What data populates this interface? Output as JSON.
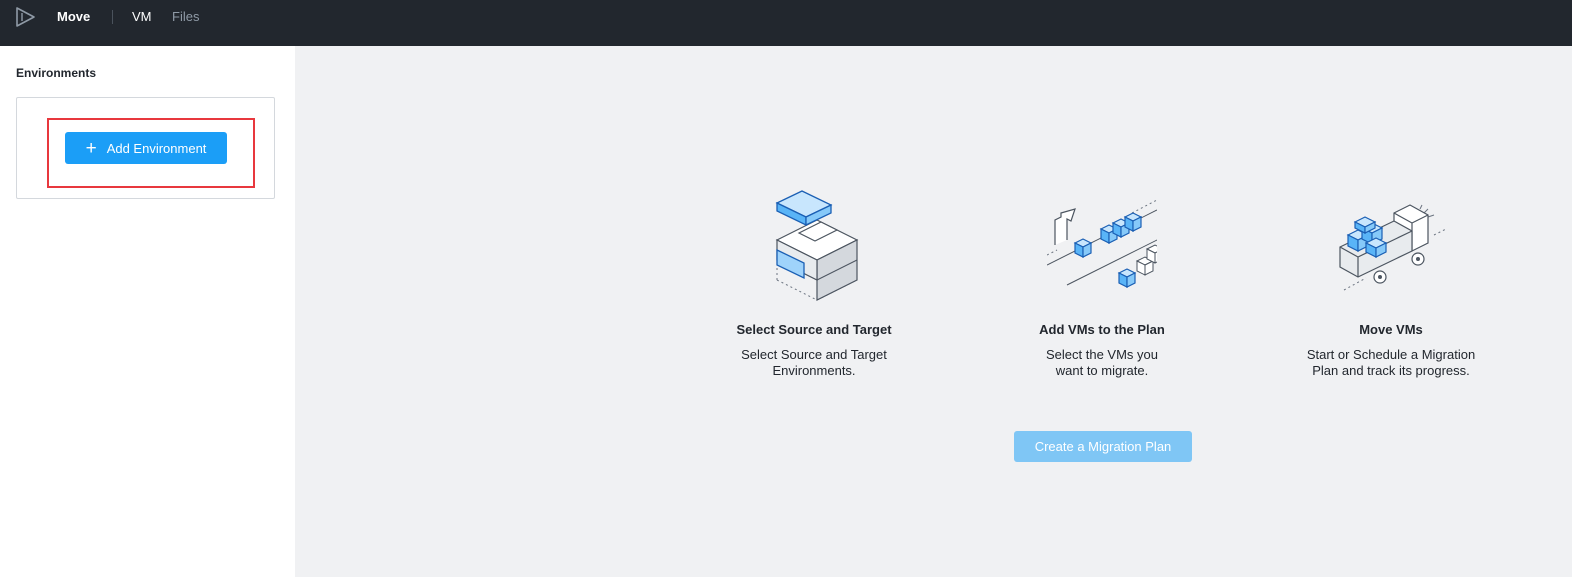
{
  "header": {
    "app_name": "Move",
    "nav": {
      "vm": "VM",
      "files": "Files"
    },
    "logo_icon": "play-logo-icon"
  },
  "sidebar": {
    "title": "Environments",
    "add_button_label": "Add Environment",
    "add_icon": "plus-icon"
  },
  "steps": [
    {
      "icon": "source-target-blocks-icon",
      "title": "Select Source and Target",
      "desc_line1": "Select Source and Target",
      "desc_line2": "Environments."
    },
    {
      "icon": "add-vms-conveyor-icon",
      "title": "Add VMs to the Plan",
      "desc_line1": "Select the VMs you",
      "desc_line2": "want to migrate."
    },
    {
      "icon": "move-vms-truck-icon",
      "title": "Move VMs",
      "desc_line1": "Start or Schedule a Migration",
      "desc_line2": "Plan and track its progress."
    }
  ],
  "create_button_label": "Create a Migration Plan",
  "colors": {
    "topbar": "#22272e",
    "accent": "#1b9ef7",
    "accent_disabled": "#7fc6f5",
    "highlight": "#e8383e",
    "content_bg": "#f0f1f3"
  }
}
